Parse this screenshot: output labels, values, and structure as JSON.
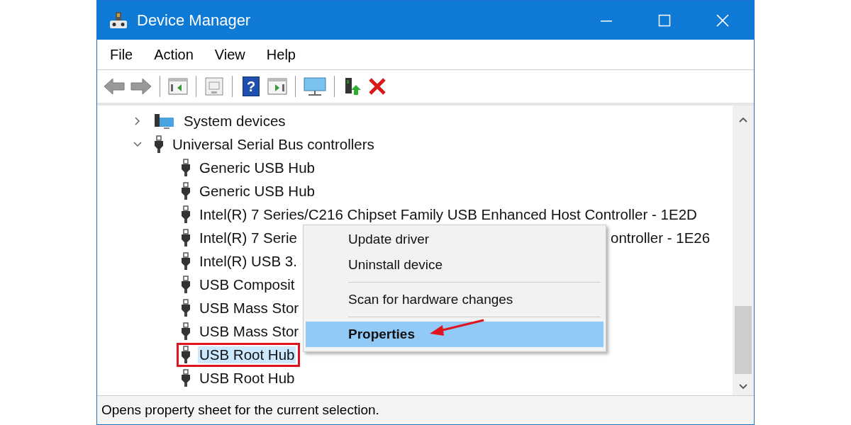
{
  "window": {
    "title": "Device Manager"
  },
  "menu_bar": [
    "File",
    "Action",
    "View",
    "Help"
  ],
  "toolbar": [
    {
      "kind": "back"
    },
    {
      "kind": "forward"
    },
    {
      "kind": "separator"
    },
    {
      "kind": "show-hide"
    },
    {
      "kind": "separator"
    },
    {
      "kind": "properties"
    },
    {
      "kind": "separator"
    },
    {
      "kind": "help",
      "glyph": "?"
    },
    {
      "kind": "action-pane"
    },
    {
      "kind": "separator"
    },
    {
      "kind": "scan"
    },
    {
      "kind": "separator"
    },
    {
      "kind": "update"
    },
    {
      "kind": "remove"
    }
  ],
  "tree": [
    {
      "label": "System devices",
      "kind": "system",
      "expanded": false,
      "selected": false
    },
    {
      "label": "Universal Serial Bus controllers",
      "kind": "usb",
      "expanded": true,
      "selected": false,
      "children": [
        {
          "label": "Generic USB Hub",
          "kind": "usb",
          "selected": false
        },
        {
          "label": "Generic USB Hub",
          "kind": "usb",
          "selected": false
        },
        {
          "label": "Intel(R) 7 Series/C216 Chipset Family USB Enhanced Host Controller - 1E2D",
          "kind": "usb",
          "selected": false
        },
        {
          "label": "Intel(R) 7 Serie",
          "label_tail": "ontroller - 1E26",
          "kind": "usb",
          "selected": false
        },
        {
          "label": "Intel(R) USB 3.",
          "kind": "usb",
          "selected": false
        },
        {
          "label": "USB Composit",
          "kind": "usb",
          "selected": false
        },
        {
          "label": "USB Mass Stor",
          "kind": "usb",
          "selected": false
        },
        {
          "label": "USB Mass Stor",
          "kind": "usb",
          "selected": false
        },
        {
          "label": "USB Root Hub",
          "kind": "usb",
          "selected": true,
          "outlined": true
        },
        {
          "label": "USB Root Hub",
          "kind": "usb",
          "selected": false
        }
      ]
    }
  ],
  "context_menu": [
    {
      "kind": "item",
      "label": "Update driver",
      "selected": false
    },
    {
      "kind": "item",
      "label": "Uninstall device",
      "selected": false
    },
    {
      "kind": "separator"
    },
    {
      "kind": "item",
      "label": "Scan for hardware changes",
      "selected": false
    },
    {
      "kind": "separator"
    },
    {
      "kind": "item",
      "label": "Properties",
      "selected": true,
      "default": true,
      "arrow": true
    }
  ],
  "status_bar": "Opens property sheet for the current selection."
}
